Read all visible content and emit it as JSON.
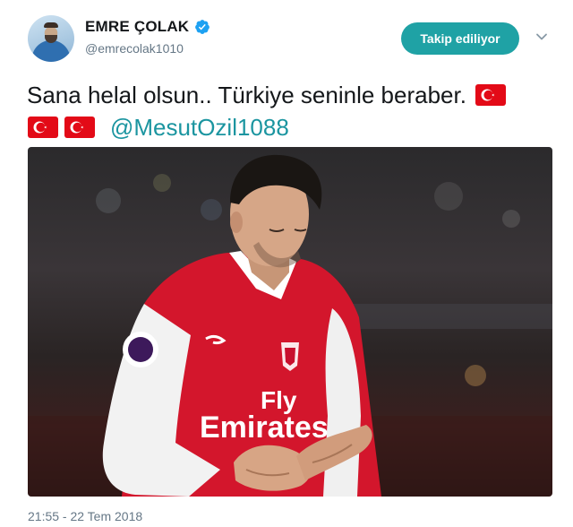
{
  "user": {
    "display_name": "EMRE ÇOLAK",
    "handle": "@emrecolak1010",
    "verified": true,
    "avatar_icon": "user-avatar"
  },
  "follow_button": {
    "label": "Takip ediliyor",
    "color": "#1fa2a5"
  },
  "menu_icon": "chevron-down-icon",
  "tweet": {
    "text_line1": "Sana helal olsun..  Türkiye seninle beraber.",
    "mention": "@MesutOzil1088",
    "flag_icon": "turkey-flag-icon",
    "mention_color": "#1b95a0"
  },
  "photo": {
    "jersey_text_line1": "Fly",
    "jersey_text_line2": "Emirates"
  },
  "timestamp": "21:55 - 22 Tem 2018"
}
